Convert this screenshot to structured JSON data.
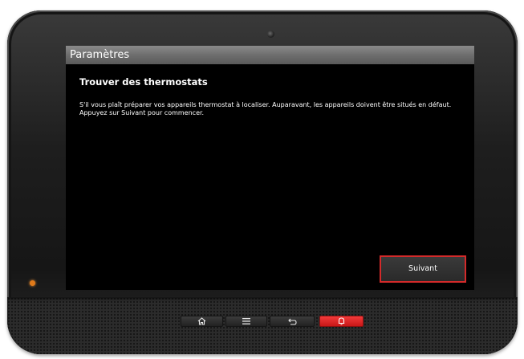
{
  "screen": {
    "title": "Paramètres",
    "heading": "Trouver des thermostats",
    "message": "S'il vous plaît préparer vos appareils thermostat à localiser. Auparavant, les appareils doivent être situés en défaut. Appuyez sur Suivant pour commencer.",
    "next_label": "Suivant"
  },
  "hardware_buttons": [
    {
      "name": "home",
      "icon": "home-icon"
    },
    {
      "name": "menu",
      "icon": "menu-icon"
    },
    {
      "name": "back",
      "icon": "back-icon"
    },
    {
      "name": "alert",
      "icon": "bell-icon"
    }
  ],
  "colors": {
    "screen_background": "#000000",
    "titlebar": "#6e6e6e",
    "button_border": "#d32a2a",
    "alert_button": "#e02424",
    "led": "#e07a1a"
  }
}
